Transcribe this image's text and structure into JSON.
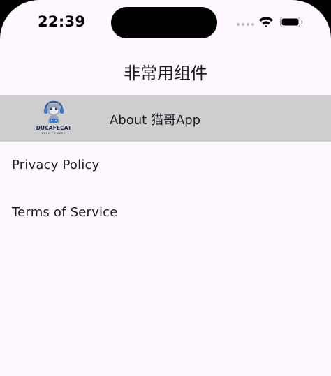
{
  "status_bar": {
    "time": "22:39",
    "icons": [
      "signal-dots-icon",
      "wifi-icon",
      "battery-icon"
    ]
  },
  "app_bar": {
    "title": "非常用组件"
  },
  "list": {
    "about": {
      "label": "About 猫哥App",
      "logo_text": "DUCAFECAT",
      "logo_subtext": "ZERO TO HERO"
    },
    "items": [
      {
        "label": "Privacy Policy"
      },
      {
        "label": "Terms of Service"
      }
    ]
  },
  "colors": {
    "background": "#FDF7FE",
    "selected_tile": "#CECECE",
    "text": "#1D1B20",
    "logo_blue": "#3A7BD5"
  }
}
